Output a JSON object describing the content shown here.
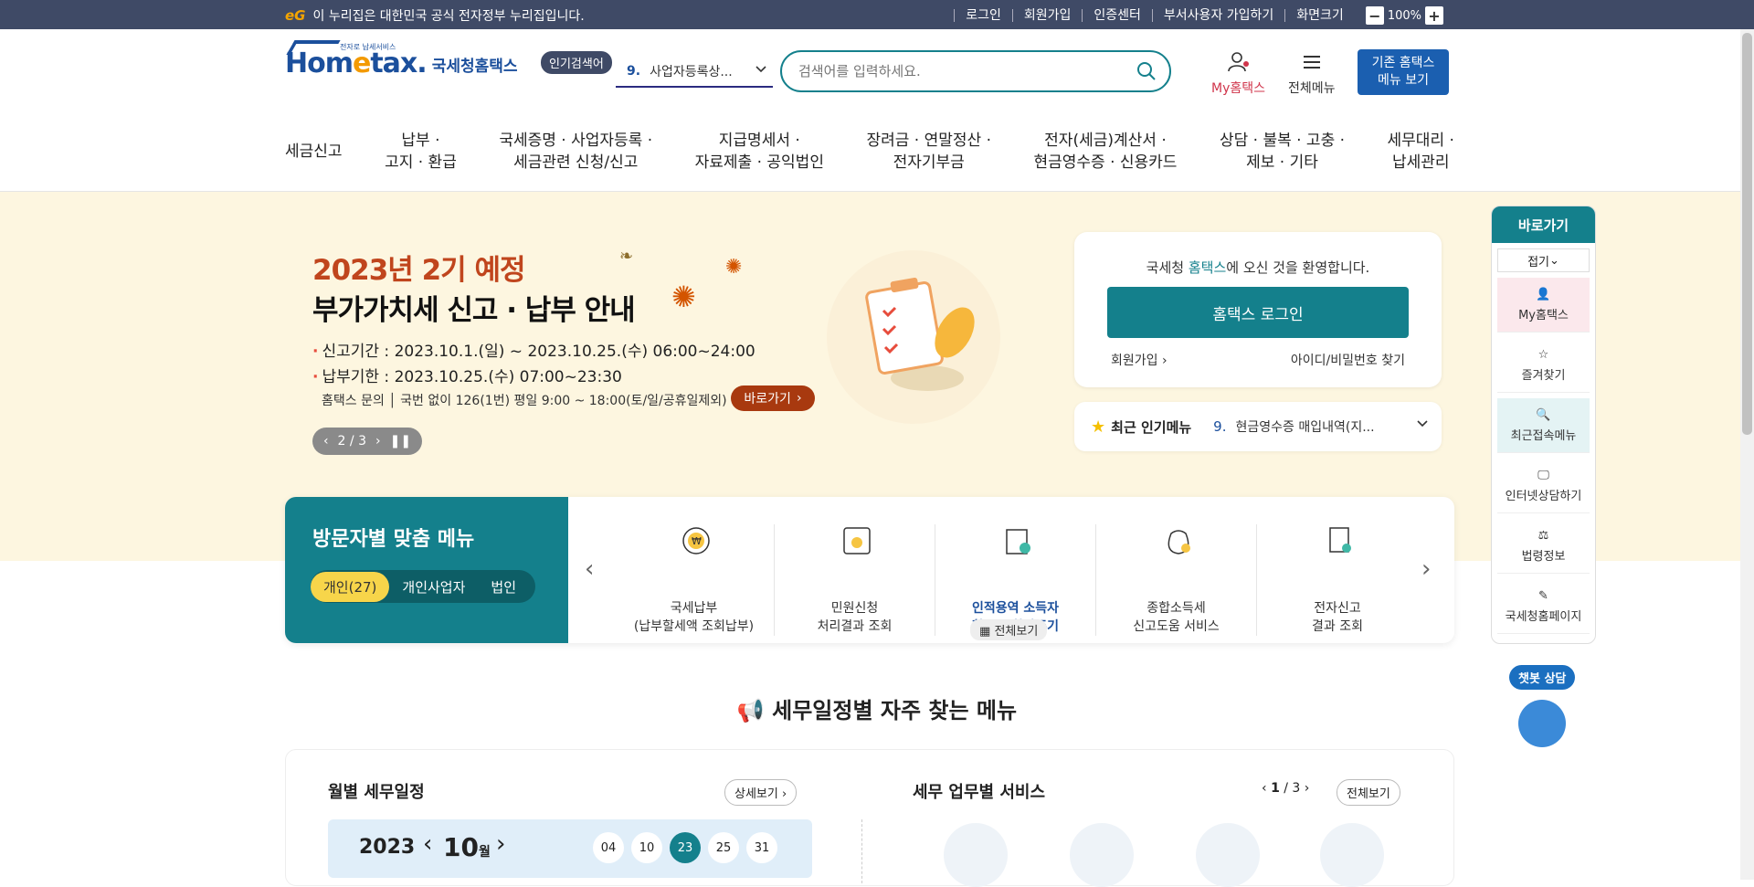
{
  "topbar": {
    "egov_logo": "eG",
    "gov_notice": "이 누리집은 대한민국 공식 전자정부 누리집입니다.",
    "links": [
      "로그인",
      "회원가입",
      "인증센터",
      "부서사용자 가입하기",
      "화면크기"
    ],
    "zoom_minus": "−",
    "zoom_value": "100%",
    "zoom_plus": "+"
  },
  "header": {
    "logo_small": "전자로 납세서비스",
    "logo_home": "Hom",
    "logo_e": "e",
    "logo_tax": "tax.",
    "logo_kr": "국세청홈택스",
    "popular_badge": "인기검색어",
    "popular_num": "9.",
    "popular_value": "사업자등록상...",
    "search_placeholder": "검색어를 입력하세요.",
    "my_label": "My홈택스",
    "all_menu_label": "전체메뉴",
    "old_site_button": "기존 홈택스\n메뉴 보기",
    "nav": [
      "세금신고",
      "납부 ·\n고지 · 환급",
      "국세증명 · 사업자등록 ·\n세금관련 신청/신고",
      "지급명세서 ·\n자료제출 · 공익법인",
      "장려금 · 연말정산 ·\n전자기부금",
      "전자(세금)계산서 ·\n현금영수증 · 신용카드",
      "상담 · 불복 · 고충 ·\n제보 · 기타",
      "세무대리 ·\n납세관리"
    ]
  },
  "hero": {
    "year_label": "2023년 2기 예정",
    "title": "부가가치세 신고 · 납부 안내",
    "period_label": "신고기간 :",
    "period_value": "2023.10.1.(일) ~ 2023.10.25.(수) 06:00~24:00",
    "due_label": "납부기한 :",
    "due_value": "2023.10.25.(수) 07:00~23:30",
    "inquiry": "홈택스 문의 │ 국번 없이 126(1번) 평일 9:00 ~ 18:00(토/일/공휴일제외)",
    "go_button": "바로가기",
    "pager": "2 / 3"
  },
  "login_card": {
    "welcome_pre": "국세청 ",
    "welcome_brand": "홈택스",
    "welcome_post": "에 오신 것을 환영합니다.",
    "login_button": "홈택스 로그인",
    "join_link": "회원가입",
    "find_link": "아이디/비밀번호 찾기"
  },
  "recent_menu": {
    "label": "최근 인기메뉴",
    "num": "9.",
    "value": "현금영수증 매입내역(지..."
  },
  "visitor": {
    "title": "방문자별 맞춤 메뉴",
    "tabs": [
      "개인(27)",
      "개인사업자",
      "법인"
    ],
    "items": [
      "국세납부\n(납부할세액 조회납부)",
      "민원신청\n처리결과 조회",
      "인적용역 소득자\n환급금 찾아주기",
      "종합소득세\n신고도움 서비스",
      "전자신고\n결과 조회"
    ],
    "all_view": "전체보기"
  },
  "schedule": {
    "section_title": "세무일정별 자주 찾는 메뉴",
    "monthly_title": "월별 세무일정",
    "detail_button": "상세보기",
    "year": "2023",
    "month": "10",
    "month_unit": "월",
    "days": [
      "04",
      "10",
      "23",
      "25",
      "31"
    ],
    "selected_day": "23",
    "service_title": "세무 업무별 서비스",
    "service_page_current": "1",
    "service_page_total": "/ 3",
    "service_all": "전체보기"
  },
  "quick": {
    "title": "바로가기",
    "fold": "접기",
    "items": [
      "My홈택스",
      "즐겨찾기",
      "최근접속메뉴",
      "인터넷상담하기",
      "법령정보",
      "국세청홈페이지"
    ]
  },
  "chatbot": {
    "label": "챗봇 상담"
  },
  "colors": {
    "accent_teal": "#14808c",
    "topbar": "#3f4a66",
    "brand_blue": "#1b4f9c",
    "hero_bg": "#fdf6e0",
    "hero_year": "#c0451d"
  }
}
